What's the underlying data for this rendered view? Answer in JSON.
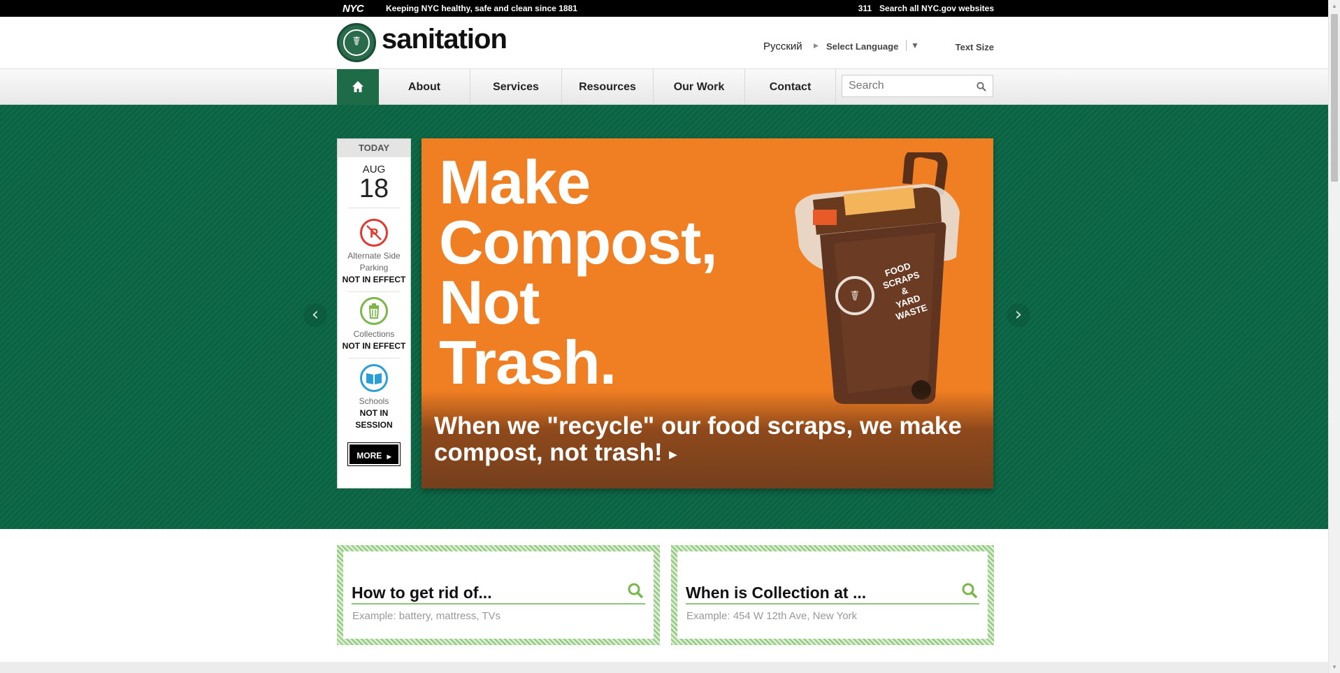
{
  "topbar": {
    "logo": "NYC",
    "tagline": "Keeping NYC healthy, safe and clean since 1881",
    "link_311": "311",
    "search_all": "Search all NYC.gov websites"
  },
  "header": {
    "site_name": "sanitation",
    "lang_current": "Русский",
    "select_language": "Select Language",
    "text_size": "Text Size"
  },
  "nav": {
    "items": [
      {
        "label": "About"
      },
      {
        "label": "Services"
      },
      {
        "label": "Resources"
      },
      {
        "label": "Our Work"
      },
      {
        "label": "Contact"
      }
    ],
    "search_placeholder": "Search"
  },
  "today": {
    "label": "TODAY",
    "month": "AUG",
    "day": "18",
    "statuses": [
      {
        "icon": "no-parking-icon",
        "label": "Alternate Side Parking",
        "value": "NOT IN EFFECT",
        "color": "#e03a2e"
      },
      {
        "icon": "trash-can-icon",
        "label": "Collections",
        "value": "NOT IN EFFECT",
        "color": "#7ab648"
      },
      {
        "icon": "book-icon",
        "label": "Schools",
        "value": "NOT IN SESSION",
        "color": "#2a9fd6"
      }
    ],
    "more": "MORE"
  },
  "slide": {
    "headline_lines": [
      "Make",
      "Compost,",
      "Not",
      "Trash."
    ],
    "caption": "When we \"recycle\" our food scraps, we make compost, not trash!",
    "bin_text": [
      "FOOD",
      "SCRAPS",
      "&",
      "YARD",
      "WASTE"
    ],
    "background": "#f07e22"
  },
  "panels": [
    {
      "title": "How to get rid of...",
      "example": "Example: battery, mattress, TVs"
    },
    {
      "title": "When is Collection at ...",
      "example": "Example: 454 W 12th Ave, New York"
    }
  ],
  "colors": {
    "brand_green": "#1d6b47",
    "accent_light_green": "#8bc47a"
  }
}
